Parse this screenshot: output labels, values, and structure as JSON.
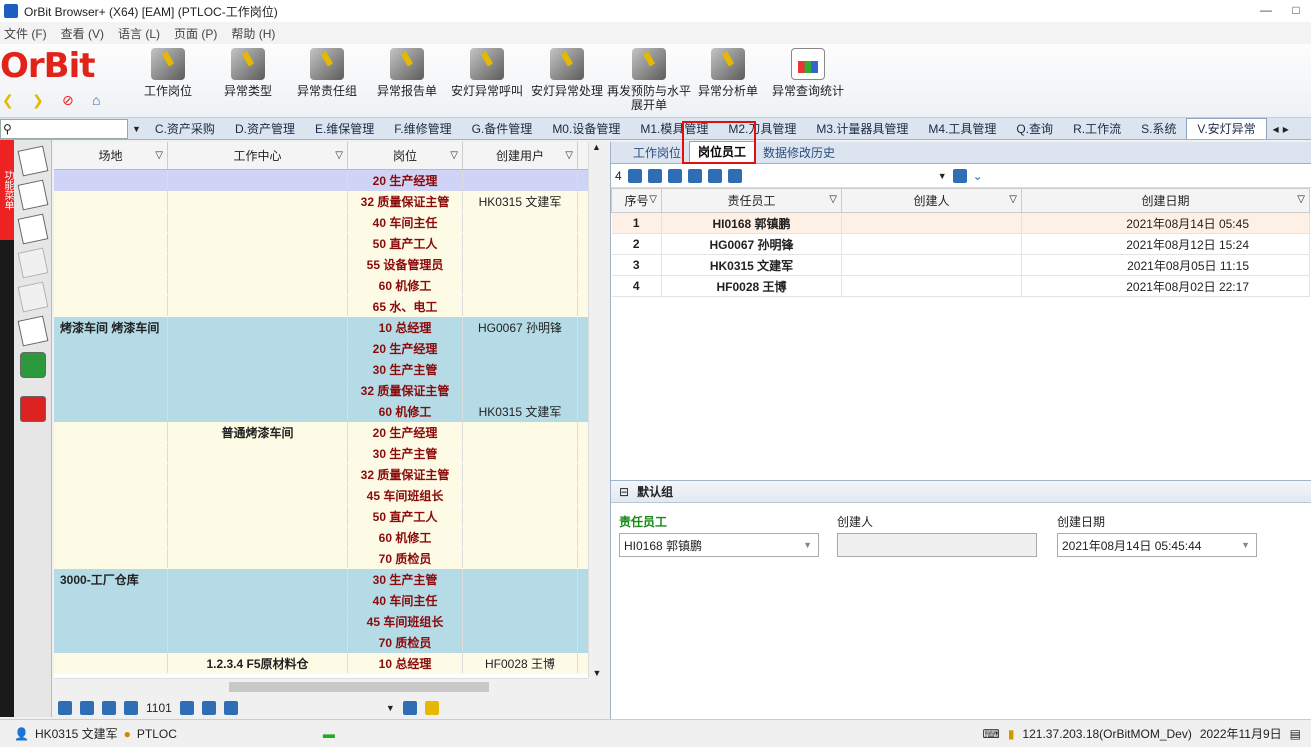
{
  "window": {
    "title": "OrBit Browser+ (X64) [EAM] (PTLOC-工作岗位)",
    "controls": [
      "—",
      "□"
    ]
  },
  "menu": [
    "文件 (F)",
    "查看 (V)",
    "语言 (L)",
    "页面 (P)",
    "帮助 (H)"
  ],
  "logo": "OrBit",
  "toolbar_buttons": [
    {
      "label": "工作岗位",
      "icon": "workstation-icon"
    },
    {
      "label": "异常类型",
      "icon": "exception-type-icon"
    },
    {
      "label": "异常责任组",
      "icon": "responsibility-group-icon"
    },
    {
      "label": "异常报告单",
      "icon": "report-icon"
    },
    {
      "label": "安灯异常呼叫",
      "icon": "andon-call-icon"
    },
    {
      "label": "安灯异常处理",
      "icon": "andon-handle-icon"
    },
    {
      "label": "再发预防与水平展开单",
      "icon": "prevention-icon"
    },
    {
      "label": "异常分析单",
      "icon": "analysis-icon"
    },
    {
      "label": "异常查询统计",
      "icon": "stats-chart-icon"
    }
  ],
  "module_tabs": [
    "C.资产采购",
    "D.资产管理",
    "E.维保管理",
    "F.维修管理",
    "G.备件管理",
    "M0.设备管理",
    "M1.模具管理",
    "M2.刀具管理",
    "M3.计量器具管理",
    "M4.工具管理",
    "Q.查询",
    "R.工作流",
    "S.系统",
    "V.安灯异常"
  ],
  "active_module_tab": "V.安灯异常",
  "sidebar_label": "功能菜单",
  "left_grid": {
    "columns": [
      "场地",
      "工作中心",
      "岗位",
      "创建用户"
    ],
    "rows": [
      {
        "site": "",
        "center": "",
        "post": "20 生产经理",
        "user": "",
        "bg": "#cfd3f5"
      },
      {
        "site": "",
        "center": "",
        "post": "32 质量保证主管",
        "user": "HK0315 文建军",
        "bg": "#fdfbe6"
      },
      {
        "site": "",
        "center": "",
        "post": "40 车间主任",
        "user": "",
        "bg": "#fdfbe6"
      },
      {
        "site": "",
        "center": "",
        "post": "50 直产工人",
        "user": "",
        "bg": "#fdfbe6"
      },
      {
        "site": "",
        "center": "",
        "post": "55 设备管理员",
        "user": "",
        "bg": "#fdfbe6"
      },
      {
        "site": "",
        "center": "",
        "post": "60 机修工",
        "user": "",
        "bg": "#fdfbe6"
      },
      {
        "site": "",
        "center": "",
        "post": "65 水、电工",
        "user": "",
        "bg": "#fdfbe6"
      },
      {
        "site": "烤漆车间 烤漆车间",
        "center": "",
        "post": "10 总经理",
        "user": "HG0067 孙明锋",
        "bg": "#b4dbe6"
      },
      {
        "site": "",
        "center": "",
        "post": "20 生产经理",
        "user": "",
        "bg": "#b4dbe6"
      },
      {
        "site": "",
        "center": "",
        "post": "30 生产主管",
        "user": "",
        "bg": "#b4dbe6"
      },
      {
        "site": "",
        "center": "",
        "post": "32 质量保证主管",
        "user": "",
        "bg": "#b4dbe6"
      },
      {
        "site": "",
        "center": "",
        "post": "60 机修工",
        "user": "HK0315 文建军",
        "bg": "#b4dbe6"
      },
      {
        "site": "",
        "center": "普通烤漆车间",
        "post": "20 生产经理",
        "user": "",
        "bg": "#fdfbe6"
      },
      {
        "site": "",
        "center": "",
        "post": "30 生产主管",
        "user": "",
        "bg": "#fdfbe6"
      },
      {
        "site": "",
        "center": "",
        "post": "32 质量保证主管",
        "user": "",
        "bg": "#fdfbe6"
      },
      {
        "site": "",
        "center": "",
        "post": "45 车间班组长",
        "user": "",
        "bg": "#fdfbe6"
      },
      {
        "site": "",
        "center": "",
        "post": "50 直产工人",
        "user": "",
        "bg": "#fdfbe6"
      },
      {
        "site": "",
        "center": "",
        "post": "60 机修工",
        "user": "",
        "bg": "#fdfbe6"
      },
      {
        "site": "",
        "center": "",
        "post": "70 质检员",
        "user": "",
        "bg": "#fdfbe6"
      },
      {
        "site": "3000-工厂仓库",
        "center": "",
        "post": "30 生产主管",
        "user": "",
        "bg": "#b4dbe6"
      },
      {
        "site": "",
        "center": "",
        "post": "40 车间主任",
        "user": "",
        "bg": "#b4dbe6"
      },
      {
        "site": "",
        "center": "",
        "post": "45 车间班组长",
        "user": "",
        "bg": "#b4dbe6"
      },
      {
        "site": "",
        "center": "",
        "post": "70 质检员",
        "user": "",
        "bg": "#b4dbe6"
      },
      {
        "site": "",
        "center": "1.2.3.4 F5原材料仓",
        "post": "10 总经理",
        "user": "HF0028 王博",
        "bg": "#fdfbe6"
      }
    ],
    "record_count": "1101"
  },
  "right_panel": {
    "subtabs": [
      "工作岗位",
      "岗位员工",
      "数据修改历史"
    ],
    "active_subtab": "岗位员工",
    "record_count": "4",
    "columns": [
      "序号",
      "责任员工",
      "创建人",
      "创建日期"
    ],
    "rows": [
      {
        "no": "1",
        "employee": "HI0168 郭镇鹏",
        "creator": "",
        "date": "2021年08月14日  05:45"
      },
      {
        "no": "2",
        "employee": "HG0067 孙明锋",
        "creator": "",
        "date": "2021年08月12日  15:24"
      },
      {
        "no": "3",
        "employee": "HK0315 文建军",
        "creator": "",
        "date": "2021年08月05日  11:15"
      },
      {
        "no": "4",
        "employee": "HF0028 王博",
        "creator": "",
        "date": "2021年08月02日  22:17"
      }
    ],
    "group_title": "默认组",
    "form": {
      "employee_label": "责任员工",
      "employee_value": "HI0168 郭镇鹏",
      "creator_label": "创建人",
      "creator_value": "",
      "date_label": "创建日期",
      "date_value": "2021年08月14日 05:45:44"
    }
  },
  "status": {
    "user": "HK0315 文建军",
    "site": "PTLOC",
    "server": "121.37.203.18(OrBitMOM_Dev)",
    "date": "2022年11月9日"
  }
}
